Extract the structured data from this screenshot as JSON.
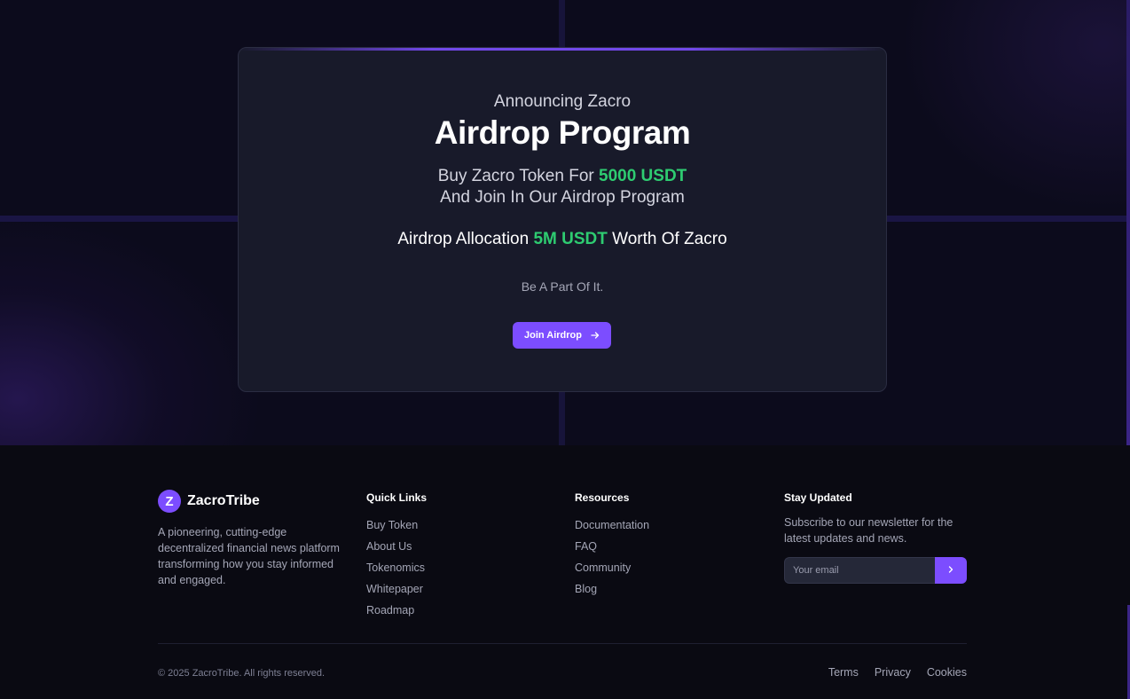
{
  "hero": {
    "kicker": "Announcing Zacro",
    "headline": "Airdrop Program",
    "buy_prefix": "Buy Zacro Token For ",
    "buy_amount": "5000 USDT",
    "join_text": "And Join In Our Airdrop Program",
    "alloc_prefix": "Airdrop Allocation ",
    "alloc_amount": "5M USDT",
    "alloc_suffix": " Worth Of Zacro",
    "tagline": "Be A Part Of It.",
    "cta_label": "Join Airdrop",
    "cta_icon": "arrow-right-icon"
  },
  "colors": {
    "accent_purple": "#7c4dff",
    "accent_green": "#2ecc71",
    "card_bg": "#181a2a",
    "page_bg": "#0a0a12"
  },
  "footer": {
    "brand": {
      "logo_letter": "Z",
      "name": "ZacroTribe",
      "description": "A pioneering, cutting-edge decentralized financial news platform transforming how you stay informed and engaged."
    },
    "quick_links": {
      "title": "Quick Links",
      "items": [
        "Buy Token",
        "About Us",
        "Tokenomics",
        "Whitepaper",
        "Roadmap"
      ]
    },
    "resources": {
      "title": "Resources",
      "items": [
        "Documentation",
        "FAQ",
        "Community",
        "Blog"
      ]
    },
    "newsletter": {
      "title": "Stay Updated",
      "text": "Subscribe to our newsletter for the latest updates and news.",
      "placeholder": "Your email",
      "submit_icon": "chevron-right-icon"
    },
    "copyright": "© 2025 ZacroTribe. All rights reserved.",
    "legal": [
      "Terms",
      "Privacy",
      "Cookies"
    ]
  }
}
